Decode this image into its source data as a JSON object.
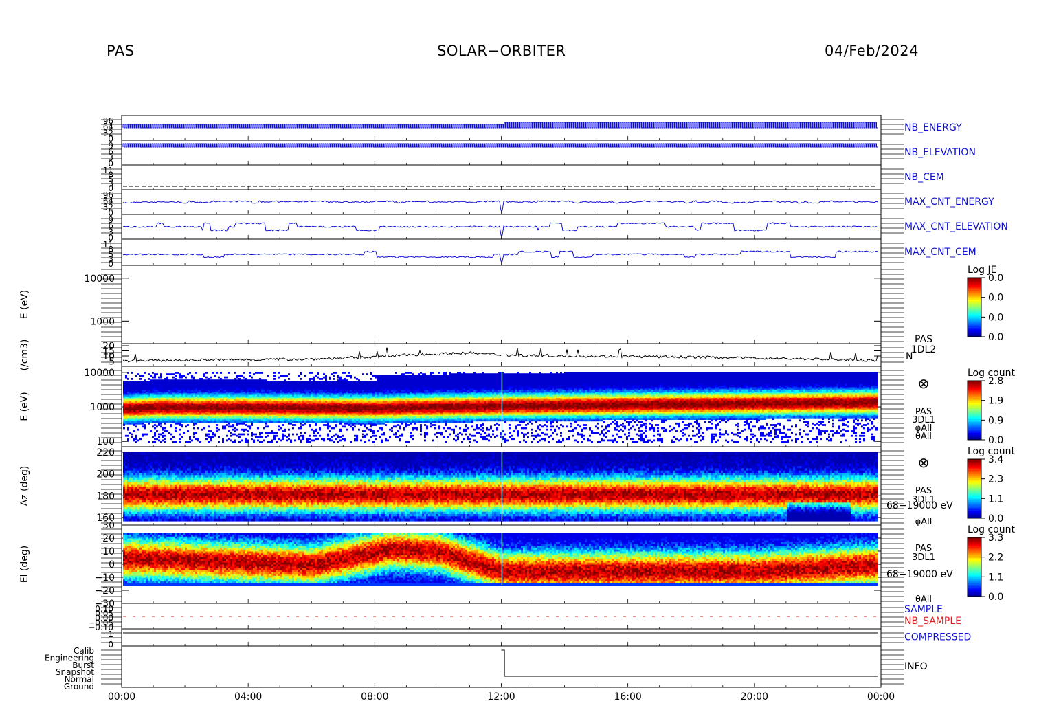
{
  "header": {
    "instrument": "PAS",
    "mission": "SOLAR−ORBITER",
    "date": "04/Feb/2024"
  },
  "colors": {
    "series_blue": "#1010d0",
    "sample_red": "#e02020",
    "axis": "#000000"
  },
  "colorbars": [
    {
      "title": "Log JE",
      "ticks": [
        "0.0",
        "0.0",
        "0.0",
        "0.0"
      ]
    },
    {
      "title": "Log count",
      "ticks": [
        "2.8",
        "1.9",
        "0.9",
        "0.0"
      ]
    },
    {
      "title": "Log count",
      "ticks": [
        "3.4",
        "2.3",
        "1.1",
        "0.0"
      ]
    },
    {
      "title": "Log count",
      "ticks": [
        "3.3",
        "2.2",
        "1.1",
        "0.0"
      ]
    }
  ],
  "chart_data": {
    "type": "heatmap",
    "x_axis": {
      "range_hours": [
        0,
        24
      ],
      "tick_labels": [
        "00:00",
        "04:00",
        "08:00",
        "12:00",
        "16:00",
        "20:00",
        "00:00"
      ]
    },
    "panels": [
      {
        "id": "nb_energy",
        "kind": "line",
        "label": "NB_ENERGY",
        "label_color": "blue",
        "tick_labels": [
          "96",
          "64",
          "32",
          "0"
        ]
      },
      {
        "id": "nb_elevation",
        "kind": "line",
        "label": "NB_ELEVATION",
        "label_color": "blue",
        "tick_labels": [
          "9",
          "6",
          "3",
          "0"
        ]
      },
      {
        "id": "nb_cem",
        "kind": "line",
        "label": "NB_CEM",
        "label_color": "blue",
        "tick_labels": [
          "11",
          "8",
          "5",
          "3",
          "0"
        ]
      },
      {
        "id": "max_cnt_energy",
        "kind": "line",
        "label": "MAX_CNT_ENERGY",
        "label_color": "blue",
        "tick_labels": [
          "96",
          "64",
          "32",
          "0"
        ]
      },
      {
        "id": "max_cnt_elevation",
        "kind": "line",
        "label": "MAX_CNT_ELEVATION",
        "label_color": "blue",
        "tick_labels": [
          "9",
          "6",
          "3",
          "0"
        ]
      },
      {
        "id": "max_cnt_cem",
        "kind": "line",
        "label": "MAX_CNT_CEM",
        "label_color": "blue",
        "tick_labels": [
          "11",
          "8",
          "5",
          "3",
          "0"
        ]
      },
      {
        "id": "energy_je",
        "kind": "spectrogram",
        "ylabel": "E (eV)",
        "scale": "log",
        "ylim": [
          300,
          20000
        ],
        "ticks": [
          1000,
          10000
        ],
        "tick_labels": [
          "1000",
          "10000"
        ],
        "side_labels": [],
        "empty": true
      },
      {
        "id": "density",
        "kind": "line",
        "ylabel": "(/cm3)",
        "ylim": [
          0,
          22
        ],
        "ticks": [
          5,
          10,
          15,
          20
        ],
        "tick_labels": [
          "5",
          "10",
          "15",
          "20"
        ],
        "side_labels": [
          "PAS",
          "1DL2",
          "N"
        ],
        "typical_values": {
          "hours": [
            0,
            2,
            4,
            6,
            8,
            9,
            10,
            11,
            12,
            14,
            16,
            18,
            20,
            22,
            24
          ],
          "n": [
            5,
            6,
            6.5,
            7,
            9,
            11,
            12,
            13,
            11,
            10,
            9.5,
            9,
            8,
            7,
            5.5
          ]
        }
      },
      {
        "id": "energy_count",
        "kind": "spectrogram",
        "ylabel": "E (eV)",
        "scale": "log",
        "ylim": [
          70,
          15000
        ],
        "ticks": [
          100,
          1000,
          10000
        ],
        "tick_labels": [
          "100",
          "1000",
          "10000"
        ],
        "side_labels": [
          "PAS",
          "3DL1",
          "φAll",
          "θAll"
        ],
        "peak_energy_ev": {
          "hours": [
            0,
            1,
            4,
            8,
            12,
            16,
            20,
            24
          ],
          "values": [
            900,
            1000,
            1000,
            950,
            1100,
            1200,
            1300,
            1400
          ]
        }
      },
      {
        "id": "azimuth",
        "kind": "spectrogram",
        "ylabel": "Az (deg)",
        "scale": "linear",
        "ylim": [
          153,
          225
        ],
        "ticks": [
          160,
          180,
          200,
          220
        ],
        "tick_labels": [
          "160",
          "180",
          "200",
          "220"
        ],
        "side_labels": [
          "PAS",
          "3DL1",
          "68−19000 eV",
          "φAll"
        ],
        "peak_az_deg": 182
      },
      {
        "id": "elevation",
        "kind": "spectrogram",
        "ylabel": "El (deg)",
        "scale": "linear",
        "ylim": [
          -30,
          30
        ],
        "ticks": [
          -30,
          -20,
          -10,
          0,
          10,
          20,
          30
        ],
        "tick_labels": [
          "−30",
          "−20",
          "−10",
          "0",
          "10",
          "20",
          "30"
        ],
        "side_labels": [
          "PAS",
          "3DL1",
          "68−19000 eV",
          "θAll"
        ],
        "peak_el_deg": {
          "hours": [
            0,
            6,
            8.5,
            10,
            12,
            16,
            20,
            24
          ],
          "values": [
            5,
            0,
            12,
            10,
            -5,
            -5,
            -5,
            0
          ]
        }
      },
      {
        "id": "sample",
        "kind": "line",
        "labels": [
          "SAMPLE",
          "NB_SAMPLE"
        ],
        "label_colors": [
          "blue",
          "red"
        ],
        "tick_labels": [
          "0.10",
          "0.05",
          "0.00",
          "−0.05",
          "−0.10"
        ]
      },
      {
        "id": "compressed",
        "kind": "line",
        "label": "COMPRESSED",
        "label_color": "blue",
        "tick_labels": [
          "1",
          "0"
        ]
      },
      {
        "id": "info",
        "kind": "state",
        "label": "INFO",
        "label_color": "black",
        "tick_labels": [
          "Calib",
          "Engineering",
          "Burst",
          "Snapshot",
          "Normal",
          "Ground"
        ],
        "transition_hour": 12.1
      }
    ],
    "colorbar_legend": "jet"
  }
}
